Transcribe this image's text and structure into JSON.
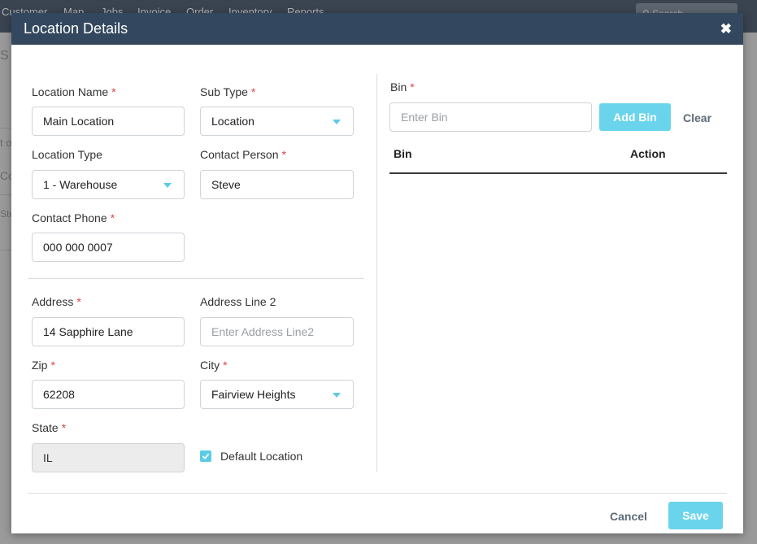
{
  "background": {
    "nav_items": [
      "Customer",
      "Map",
      "Jobs",
      "Invoice",
      "Order",
      "Inventory",
      "Reports"
    ],
    "search_placeholder": "Search",
    "fragments": [
      "S",
      "t o",
      "Co",
      "Ste"
    ]
  },
  "modal": {
    "title": "Location Details",
    "close_icon": "close-icon"
  },
  "form": {
    "location_name": {
      "label": "Location Name",
      "required": "*",
      "value": "Main Location"
    },
    "sub_type": {
      "label": "Sub Type",
      "required": "*",
      "value": "Location"
    },
    "location_type": {
      "label": "Location Type",
      "value": "1 - Warehouse"
    },
    "contact_person": {
      "label": "Contact Person",
      "required": "*",
      "value": "Steve"
    },
    "contact_phone": {
      "label": "Contact Phone",
      "required": "*",
      "value": "000 000 0007"
    },
    "address": {
      "label": "Address",
      "required": "*",
      "value": "14 Sapphire Lane"
    },
    "address_line2": {
      "label": "Address Line 2",
      "placeholder": "Enter Address Line2"
    },
    "zip": {
      "label": "Zip",
      "required": "*",
      "value": "62208"
    },
    "city": {
      "label": "City",
      "required": "*",
      "value": "Fairview Heights"
    },
    "state": {
      "label": "State",
      "required": "*",
      "value": "IL"
    },
    "default_location": {
      "label": "Default Location",
      "checked": true
    }
  },
  "bin": {
    "label": "Bin",
    "required": "*",
    "placeholder": "Enter Bin",
    "add_label": "Add Bin",
    "clear_label": "Clear",
    "columns": [
      "Bin",
      "Action"
    ]
  },
  "footer": {
    "cancel_label": "Cancel",
    "save_label": "Save"
  },
  "colors": {
    "header": "#33485e",
    "accent": "#6ad4ec",
    "required": "#e04646"
  }
}
